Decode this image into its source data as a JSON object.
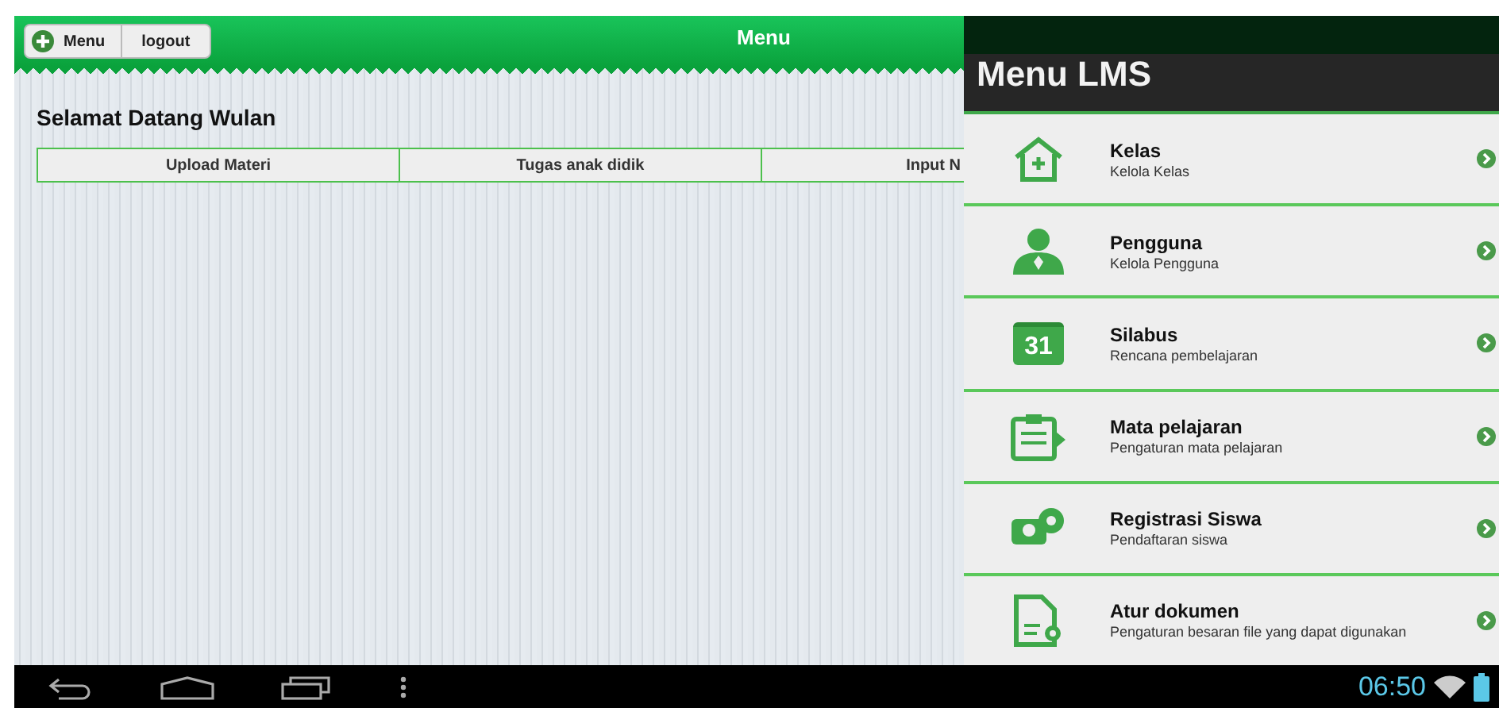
{
  "header": {
    "menu_button": "Menu",
    "logout_button": "logout",
    "title": "Menu"
  },
  "welcome": "Selamat Datang Wulan",
  "tabs": [
    {
      "label": "Upload Materi"
    },
    {
      "label": "Tugas anak didik"
    },
    {
      "label": "Input N"
    }
  ],
  "drawer": {
    "title": "Menu LMS",
    "items": [
      {
        "title": "Kelas",
        "subtitle": "Kelola Kelas"
      },
      {
        "title": "Pengguna",
        "subtitle": "Kelola Pengguna"
      },
      {
        "title": "Silabus",
        "subtitle": "Rencana pembelajaran",
        "icon_text": "31"
      },
      {
        "title": "Mata pelajaran",
        "subtitle": "Pengaturan mata pelajaran"
      },
      {
        "title": "Registrasi Siswa",
        "subtitle": "Pendaftaran siswa"
      },
      {
        "title": "Atur dokumen",
        "subtitle": "Pengaturan besaran file yang dapat digunakan"
      }
    ]
  },
  "status_bar": {
    "time": "06:50"
  }
}
